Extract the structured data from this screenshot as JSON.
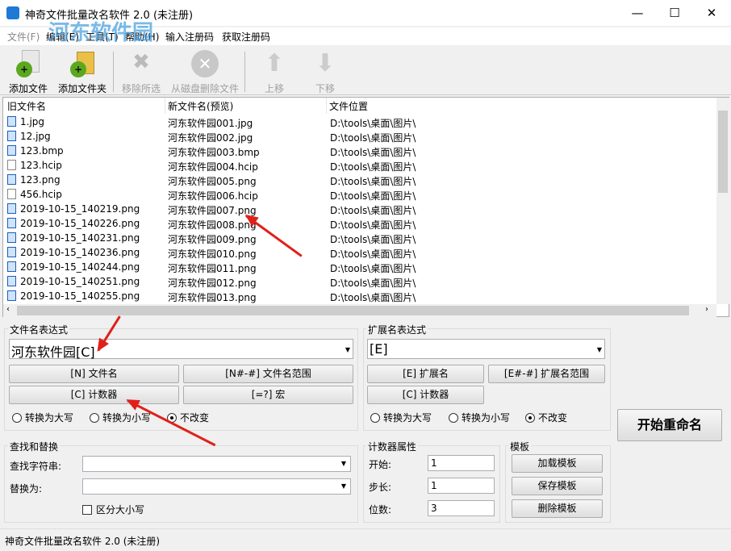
{
  "window": {
    "title": "神奇文件批量改名软件 2.0 (未注册)",
    "minimize": "—",
    "maximize": "☐",
    "close": "✕"
  },
  "watermark": {
    "line1": "河东软件园",
    "line2": "www.pc0359.cn"
  },
  "menu": [
    "文件(F)",
    "编辑(E)",
    "工具(T)",
    "帮助(H)",
    "输入注册码",
    "获取注册码"
  ],
  "toolbar": [
    {
      "label": "添加文件",
      "icon": "add-file-icon",
      "enabled": true
    },
    {
      "label": "添加文件夹",
      "icon": "add-folder-icon",
      "enabled": true
    },
    {
      "label": "移除所选",
      "icon": "remove-selected-icon",
      "enabled": false
    },
    {
      "label": "从磁盘删除文件",
      "icon": "delete-from-disk-icon",
      "enabled": false
    },
    {
      "label": "上移",
      "icon": "arrow-up-icon",
      "enabled": false
    },
    {
      "label": "下移",
      "icon": "arrow-down-icon",
      "enabled": false
    }
  ],
  "list": {
    "columns": [
      "旧文件名",
      "新文件名(预览)",
      "文件位置"
    ],
    "rows": [
      {
        "old": "1.jpg",
        "new": "河东软件园001.jpg",
        "path": "D:\\tools\\桌面\\图片\\",
        "icon": "image"
      },
      {
        "old": "12.jpg",
        "new": "河东软件园002.jpg",
        "path": "D:\\tools\\桌面\\图片\\",
        "icon": "image"
      },
      {
        "old": "123.bmp",
        "new": "河东软件园003.bmp",
        "path": "D:\\tools\\桌面\\图片\\",
        "icon": "image"
      },
      {
        "old": "123.hcip",
        "new": "河东软件园004.hcip",
        "path": "D:\\tools\\桌面\\图片\\",
        "icon": "file"
      },
      {
        "old": "123.png",
        "new": "河东软件园005.png",
        "path": "D:\\tools\\桌面\\图片\\",
        "icon": "image"
      },
      {
        "old": "456.hcip",
        "new": "河东软件园006.hcip",
        "path": "D:\\tools\\桌面\\图片\\",
        "icon": "file"
      },
      {
        "old": "2019-10-15_140219.png",
        "new": "河东软件园007.png",
        "path": "D:\\tools\\桌面\\图片\\",
        "icon": "image"
      },
      {
        "old": "2019-10-15_140226.png",
        "new": "河东软件园008.png",
        "path": "D:\\tools\\桌面\\图片\\",
        "icon": "image"
      },
      {
        "old": "2019-10-15_140231.png",
        "new": "河东软件园009.png",
        "path": "D:\\tools\\桌面\\图片\\",
        "icon": "image"
      },
      {
        "old": "2019-10-15_140236.png",
        "new": "河东软件园010.png",
        "path": "D:\\tools\\桌面\\图片\\",
        "icon": "image"
      },
      {
        "old": "2019-10-15_140244.png",
        "new": "河东软件园011.png",
        "path": "D:\\tools\\桌面\\图片\\",
        "icon": "image"
      },
      {
        "old": "2019-10-15_140251.png",
        "new": "河东软件园012.png",
        "path": "D:\\tools\\桌面\\图片\\",
        "icon": "image"
      },
      {
        "old": "2019-10-15_140255.png",
        "new": "河东软件园013.png",
        "path": "D:\\tools\\桌面\\图片\\",
        "icon": "image"
      }
    ]
  },
  "filename_expr": {
    "label": "文件名表达式",
    "value": "河东软件园[C]",
    "buttons": [
      "[N] 文件名",
      "[N#-#] 文件名范围",
      "[C] 计数器",
      "[=?] 宏"
    ],
    "radios": [
      "转换为大写",
      "转换为小写",
      "不改变"
    ],
    "selected": 2
  },
  "ext_expr": {
    "label": "扩展名表达式",
    "value": "[E]",
    "buttons": [
      "[E] 扩展名",
      "[E#-#] 扩展名范围",
      "[C] 计数器"
    ],
    "radios": [
      "转换为大写",
      "转换为小写",
      "不改变"
    ],
    "selected": 2
  },
  "start_button": "开始重命名",
  "find_replace": {
    "label": "查找和替换",
    "find_label": "查找字符串:",
    "find_value": "",
    "replace_label": "替换为:",
    "replace_value": "",
    "case_label": "区分大小写",
    "case_checked": false
  },
  "counter": {
    "label": "计数器属性",
    "start_label": "开始:",
    "start": "1",
    "step_label": "步长:",
    "step": "1",
    "digits_label": "位数:",
    "digits": "3"
  },
  "template": {
    "label": "模板",
    "load": "加载模板",
    "save": "保存模板",
    "delete": "删除模板"
  },
  "status": "神奇文件批量改名软件 2.0 (未注册)"
}
